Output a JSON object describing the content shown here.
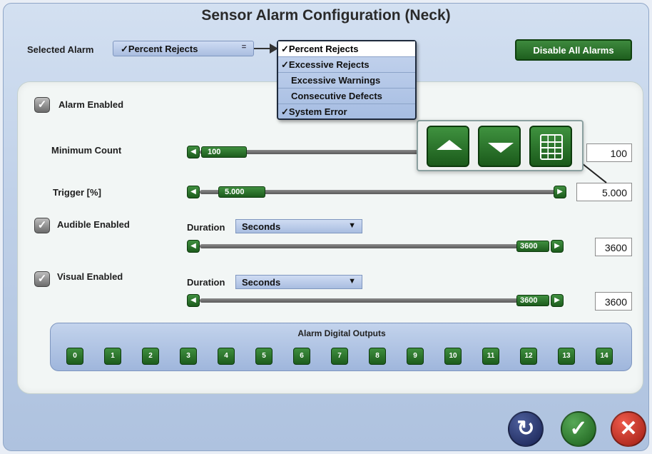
{
  "title": "Sensor Alarm Configuration (Neck)",
  "selected_alarm": {
    "label": "Selected Alarm",
    "value": "✓Percent Rejects",
    "arrow_icon": "="
  },
  "dropdown": {
    "items": [
      {
        "label": "✓Percent Rejects"
      },
      {
        "label": "✓Excessive Rejects"
      },
      {
        "label": "Excessive Warnings"
      },
      {
        "label": "Consecutive Defects"
      },
      {
        "label": "✓System Error"
      }
    ]
  },
  "disable_all_label": "Disable All Alarms",
  "alarm_enabled": {
    "label": "Alarm Enabled",
    "check": "✓"
  },
  "minimum_count": {
    "label": "Minimum Count",
    "thumb": "100",
    "value": "100"
  },
  "trigger": {
    "label": "Trigger [%]",
    "thumb": "5.000",
    "value": "5.000"
  },
  "audible": {
    "label": "Audible Enabled",
    "check": "✓",
    "duration_label": "Duration",
    "duration_unit": "Seconds",
    "thumb": "3600",
    "value": "3600"
  },
  "visual": {
    "label": "Visual Enabled",
    "check": "✓",
    "duration_label": "Duration",
    "duration_unit": "Seconds",
    "thumb": "3600",
    "value": "3600"
  },
  "outputs": {
    "title": "Alarm Digital Outputs",
    "buttons": [
      "0",
      "1",
      "2",
      "3",
      "4",
      "5",
      "6",
      "7",
      "8",
      "9",
      "10",
      "11",
      "12",
      "13",
      "14"
    ]
  },
  "icons": {
    "slider_left": "◀",
    "slider_right": "▶",
    "caret": "▼",
    "reset": "↻",
    "ok": "✓",
    "cancel": "✕"
  },
  "colors": {
    "accent_green": "#2a742a",
    "panel_blue": "#b3c6e4",
    "cancel_red": "#c8281c",
    "reset_navy": "#1f2b60"
  }
}
